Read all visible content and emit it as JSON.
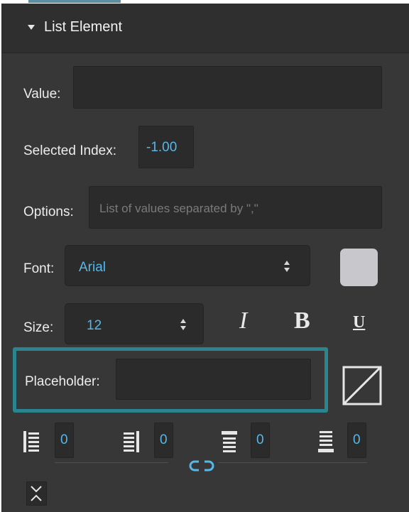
{
  "section": {
    "title": "List Element"
  },
  "value": {
    "label": "Value:",
    "current": ""
  },
  "selected_index": {
    "label": "Selected Index:",
    "current": "-1.00"
  },
  "options": {
    "label": "Options:",
    "placeholder": "List of values separated by \",\""
  },
  "font": {
    "label": "Font:",
    "current": "Arial",
    "color_swatch": "#c8c8cc"
  },
  "size": {
    "label": "Size:",
    "current": "12"
  },
  "style_buttons": {
    "italic": "I",
    "bold": "B",
    "underline": "U"
  },
  "placeholder_field": {
    "label": "Placeholder:",
    "current": ""
  },
  "alignment": {
    "left": {
      "icon": "align-left-icon",
      "value": "0"
    },
    "right": {
      "icon": "align-right-icon",
      "value": "0"
    },
    "top": {
      "icon": "align-top-icon",
      "value": "0"
    },
    "bottom": {
      "icon": "align-bottom-icon",
      "value": "0"
    }
  },
  "colors": {
    "accent": "#56b8e8",
    "highlight": "#2a8590",
    "panel": "#373737"
  }
}
